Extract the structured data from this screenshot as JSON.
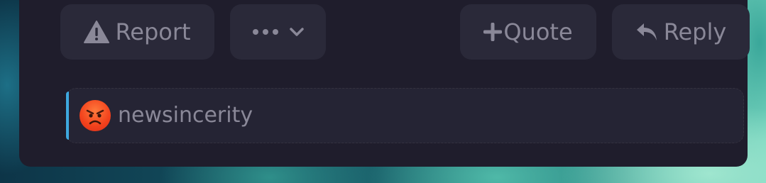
{
  "colors": {
    "card_background": "#1f1d2c",
    "button_background": "#2a2939",
    "text_muted": "#8a8898",
    "mention_accent": "#3ea8df"
  },
  "actions": {
    "report_label": "Report",
    "quote_label": "Quote",
    "reply_label": "Reply"
  },
  "icons": {
    "report": "warning-triangle-icon",
    "more": "ellipsis-icon",
    "more_chevron": "chevron-down-icon",
    "quote": "plus-icon",
    "reply": "reply-arrow-icon",
    "avatar": "angry-face-emoji"
  },
  "mention": {
    "username": "newsincerity"
  }
}
